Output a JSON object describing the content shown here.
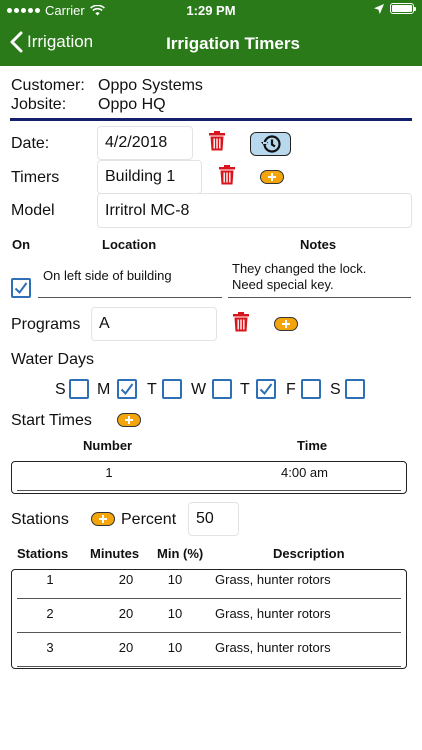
{
  "status": {
    "carrier": "Carrier",
    "time": "1:29 PM"
  },
  "nav": {
    "back_label": "Irrigation",
    "title": "Irrigation Timers"
  },
  "customer": {
    "customer_label": "Customer:",
    "customer_value": "Oppo Systems",
    "jobsite_label": "Jobsite:",
    "jobsite_value": "Oppo HQ"
  },
  "form": {
    "date_label": "Date:",
    "date_value": "4/2/2018",
    "timers_label": "Timers",
    "timers_value": "Building 1",
    "model_label": "Model",
    "model_value": "Irritrol MC-8",
    "on_header": "On",
    "location_header": "Location",
    "notes_header": "Notes",
    "location_value": "On left side of building",
    "notes_line1": "They changed the lock.",
    "notes_line2": "Need special key.",
    "programs_label": "Programs",
    "programs_value": "A",
    "water_days_label": "Water Days",
    "start_times_label": "Start Times",
    "stations_label": "Stations",
    "percent_label": "Percent",
    "percent_value": "50"
  },
  "water_days": [
    {
      "letter": "S",
      "checked": false
    },
    {
      "letter": "M",
      "checked": true
    },
    {
      "letter": "T",
      "checked": false
    },
    {
      "letter": "W",
      "checked": false
    },
    {
      "letter": "T",
      "checked": true
    },
    {
      "letter": "F",
      "checked": false
    },
    {
      "letter": "S",
      "checked": false
    }
  ],
  "start_times": {
    "headers": {
      "number": "Number",
      "time": "Time"
    },
    "rows": [
      {
        "number": "1",
        "time": "4:00 am"
      }
    ]
  },
  "stations": {
    "headers": {
      "stations": "Stations",
      "minutes": "Minutes",
      "min_pct": "Min (%)",
      "description": "Description"
    },
    "rows": [
      {
        "station": "1",
        "minutes": "20",
        "min_pct": "10",
        "description": "Grass, hunter rotors"
      },
      {
        "station": "2",
        "minutes": "20",
        "min_pct": "10",
        "description": "Grass, hunter rotors"
      },
      {
        "station": "3",
        "minutes": "20",
        "min_pct": "10",
        "description": "Grass, hunter rotors"
      }
    ]
  },
  "colors": {
    "nav_green": "#2a7a19",
    "divider_navy": "#14206b",
    "trash_red": "#d8141c",
    "add_orange": "#f4a50c",
    "checkbox_blue": "#2e6fb5"
  }
}
